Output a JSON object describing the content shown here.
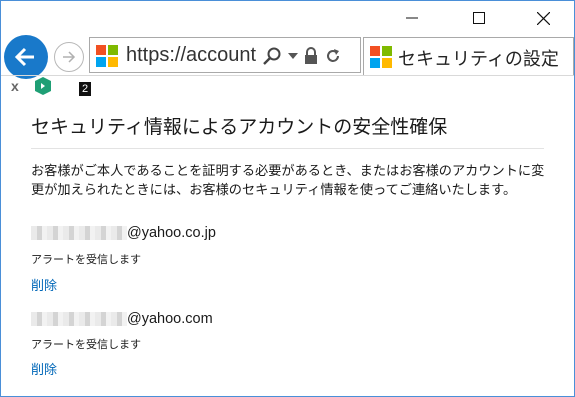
{
  "browser": {
    "url": "https://account.l",
    "tab_title": "セキュリティの設定",
    "favorites": {
      "close_label": "x",
      "extension_badge": "2"
    },
    "colors": {
      "back_button": "#1979ca",
      "logo_red": "#f25022",
      "logo_green": "#7fba00",
      "logo_blue": "#00a4ef",
      "logo_yellow": "#ffb900"
    }
  },
  "page": {
    "title": "セキュリティ情報によるアカウントの安全性確保",
    "description": "お客様がご本人であることを証明する必要があるとき、またはお客様のアカウントに変更が加えられたときには、お客様のセキュリティ情報を使ってご連絡いたします。",
    "link_color": "#0067b8",
    "entries": [
      {
        "email_domain": "@yahoo.co.jp",
        "alert": "アラートを受信します",
        "delete_label": "削除"
      },
      {
        "email_domain": "@yahoo.com",
        "alert": "アラートを受信します",
        "delete_label": "削除"
      }
    ]
  }
}
